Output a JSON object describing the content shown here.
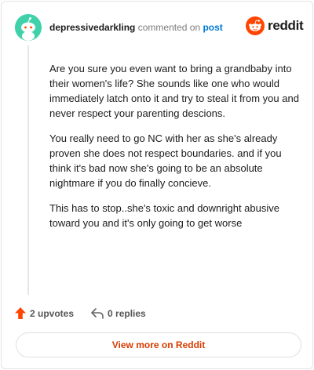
{
  "header": {
    "username": "depressivedarkling",
    "commented_text": "commented on",
    "post_link": "post"
  },
  "brand": {
    "name": "reddit",
    "icon": "reddit-logo-icon",
    "color": "#ff4500"
  },
  "avatar": {
    "icon": "snoo-avatar-icon",
    "color": "#3fd1a9"
  },
  "comment": {
    "paragraphs": [
      "Are you sure you even want to bring a grandbaby into their women's life? She sounds like one who would immediately latch onto it and try to steal it from you and never respect your parenting descions.",
      "You really need to go NC with her as she's already proven she does not respect boundaries. and if you think it's bad now she's going to be an absolute nightmare if you do finally concieve.",
      "This has to stop..she's toxic and downright abusive toward you and it's only going to get worse"
    ]
  },
  "actions": {
    "upvotes_label": "2 upvotes",
    "upvote_icon": "upvote-arrow-icon",
    "upvote_color": "#ff4500",
    "replies_label": "0 replies",
    "reply_icon": "reply-arrow-icon"
  },
  "footer": {
    "view_more_label": "View more on Reddit",
    "accent": "#d93a00"
  }
}
